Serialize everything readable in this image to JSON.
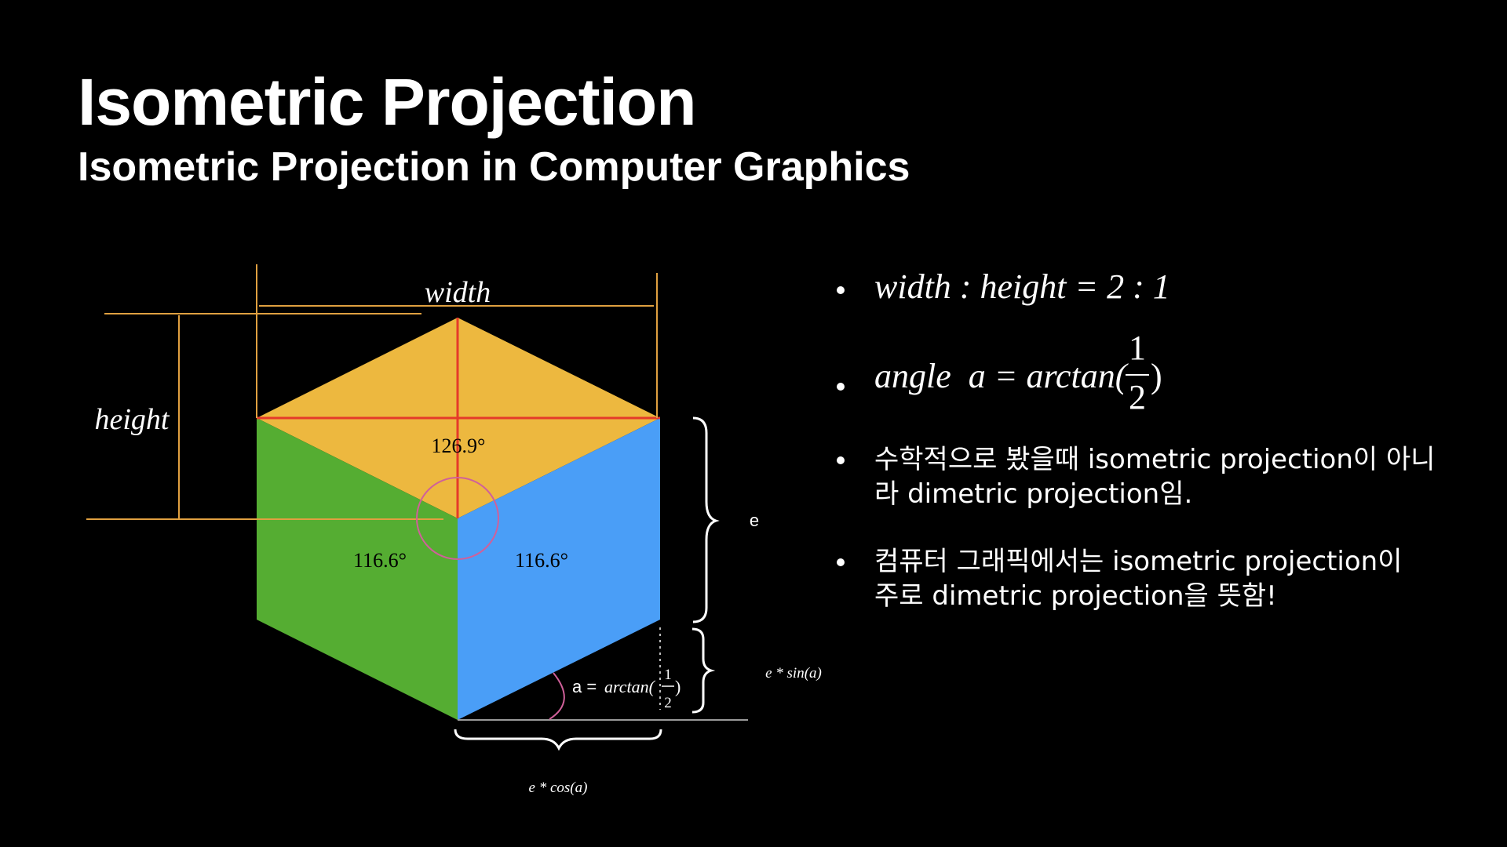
{
  "header": {
    "title": "Isometric Projection",
    "subtitle": "Isometric Projection in Computer Graphics"
  },
  "diagram": {
    "colors": {
      "top_face": "#EDB83F",
      "left_face": "#55AD32",
      "right_face": "#4A9EF7",
      "guide_lines": "#E0A040",
      "diagonal_lines": "#E53A2A",
      "angle_arc": "#D0609A"
    },
    "labels": {
      "width": "width",
      "height": "height",
      "angle_top": "126.9°",
      "angle_left": "116.6°",
      "angle_right": "116.6°",
      "e": "e",
      "e_sin": "e * sin(a)",
      "e_cos": "e * cos(a)",
      "angle_formula_prefix": "a = ",
      "angle_formula_fn": "arctan(",
      "angle_formula_num": "1",
      "angle_formula_den": "2",
      "angle_formula_close": ")"
    }
  },
  "bullets": {
    "b1": "width : height = 2 : 1",
    "b2_prefix": "angle  a = arctan(",
    "b2_num": "1",
    "b2_den": "2",
    "b2_close": ")",
    "b3_line1": "수학적으로 봤을때 isometric projection이 아니",
    "b3_line2": "라 dimetric projection임.",
    "b4_line1": "컴퓨터 그래픽에서는 isometric projection이",
    "b4_line2": "주로 dimetric projection을 뜻함!"
  }
}
